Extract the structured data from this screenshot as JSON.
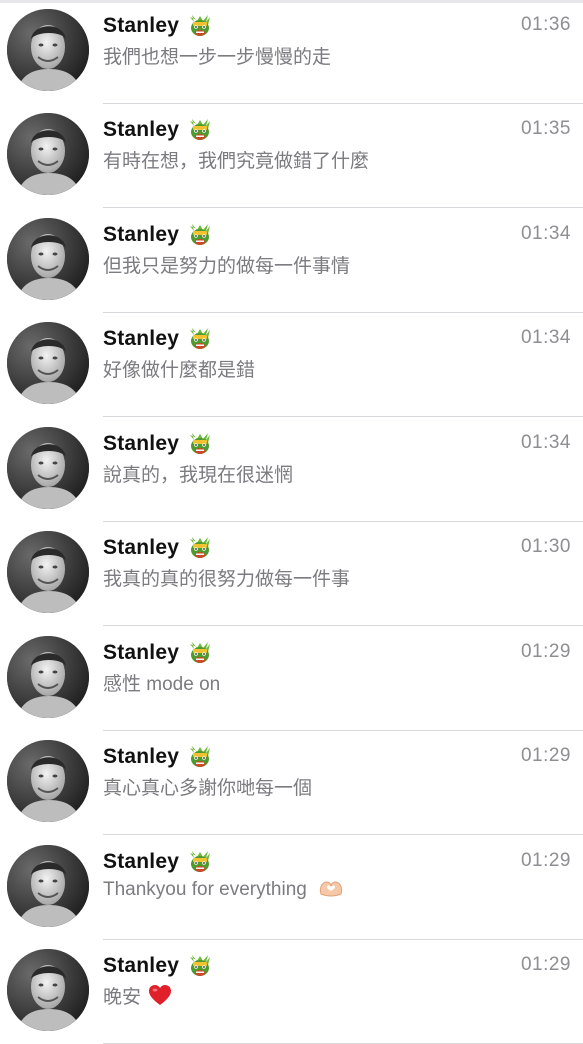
{
  "messages": [
    {
      "name": "Stanley",
      "time": "01:36",
      "preview": "我們也想一步一步慢慢的走",
      "trailing_emoji": null
    },
    {
      "name": "Stanley",
      "time": "01:35",
      "preview": "有時在想，我們究竟做錯了什麼",
      "trailing_emoji": null
    },
    {
      "name": "Stanley",
      "time": "01:34",
      "preview": "但我只是努力的做每一件事情",
      "trailing_emoji": null
    },
    {
      "name": "Stanley",
      "time": "01:34",
      "preview": "好像做什麼都是錯",
      "trailing_emoji": null
    },
    {
      "name": "Stanley",
      "time": "01:34",
      "preview": "說真的，我現在很迷惘",
      "trailing_emoji": null
    },
    {
      "name": "Stanley",
      "time": "01:30",
      "preview": "我真的真的很努力做每一件事",
      "trailing_emoji": null
    },
    {
      "name": "Stanley",
      "time": "01:29",
      "preview": "感性 mode on",
      "trailing_emoji": null
    },
    {
      "name": "Stanley",
      "time": "01:29",
      "preview": "真心真心多謝你哋每一個",
      "trailing_emoji": null
    },
    {
      "name": "Stanley",
      "time": "01:29",
      "preview": "Thankyou for everything",
      "trailing_emoji": "heart-hands-icon"
    },
    {
      "name": "Stanley",
      "time": "01:29",
      "preview": "晚安",
      "trailing_emoji": "red-heart-icon"
    }
  ],
  "name_emoji": "dragon-face-icon",
  "colors": {
    "name": "#111111",
    "time": "#8e8e93",
    "preview": "#7b7b80",
    "separator": "#d9d9dd",
    "heart": "#e0212b",
    "dragon": "#4f9a2c"
  }
}
